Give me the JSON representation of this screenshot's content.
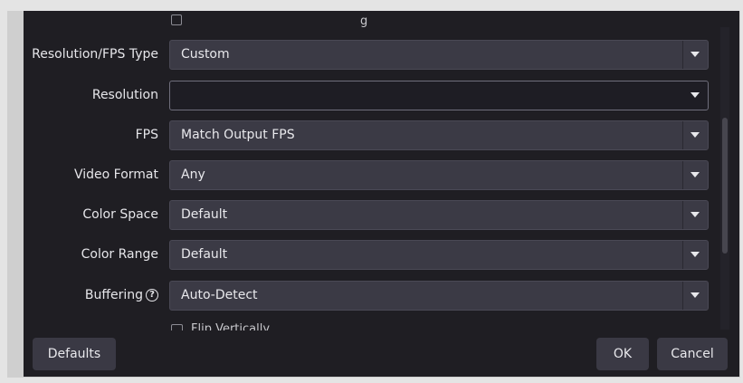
{
  "top_partial": {
    "text": "g"
  },
  "rows": [
    {
      "label": "Resolution/FPS Type",
      "value": "Custom"
    },
    {
      "label": "Resolution",
      "value": ""
    },
    {
      "label": "FPS",
      "value": "Match Output FPS"
    },
    {
      "label": "Video Format",
      "value": "Any"
    },
    {
      "label": "Color Space",
      "value": "Default"
    },
    {
      "label": "Color Range",
      "value": "Default"
    },
    {
      "label": "Buffering",
      "value": "Auto-Detect"
    }
  ],
  "bottom_partial": {
    "text": "Flip Vertically"
  },
  "footer": {
    "defaults_label": "Defaults",
    "ok_label": "OK",
    "cancel_label": "Cancel"
  },
  "icons": {
    "dropdown": "chevron-down-icon",
    "help": "help-circle-icon"
  },
  "colors": {
    "dialog_bg": "#1f1e23",
    "combo_bg": "#3b3a45",
    "button_bg": "#3a3944",
    "text": "#e6e6ea"
  }
}
